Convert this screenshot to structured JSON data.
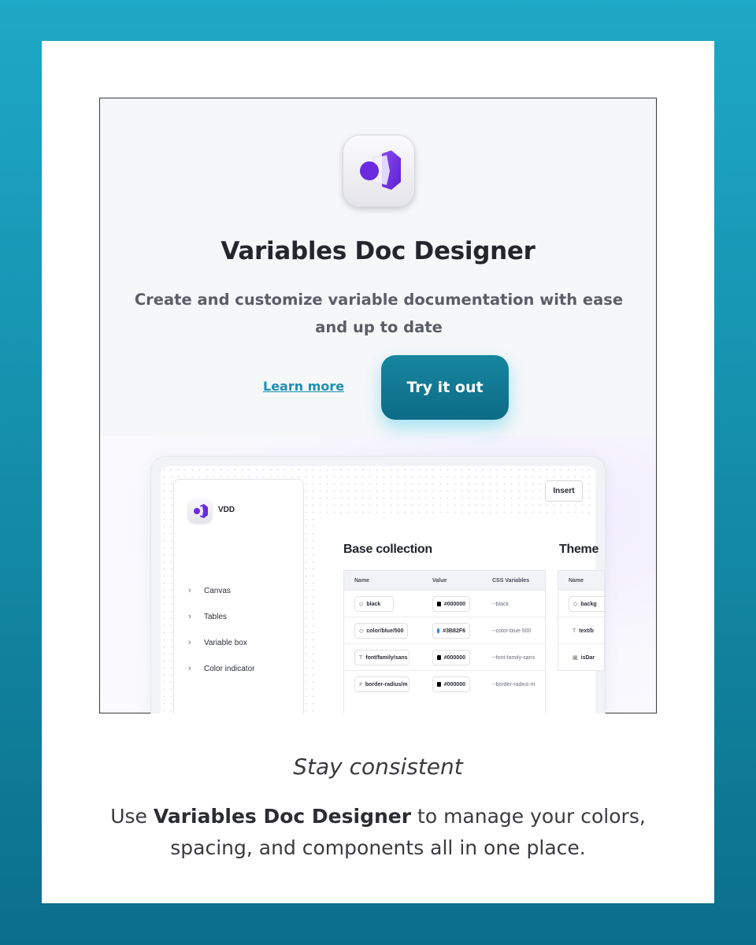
{
  "hero": {
    "title": "Variables Doc Designer",
    "subtitle": "Create and customize variable documentation with ease and up to date",
    "learn_more": "Learn more",
    "try_button": "Try it out",
    "accent_color": "#0d6b86",
    "icon": "variables-doc-designer-app-icon"
  },
  "preview": {
    "app_short_name": "VDD",
    "insert_button": "Insert",
    "nav": [
      "Canvas",
      "Tables",
      "Variable box",
      "Color indicator"
    ],
    "collection_title": "Base collection",
    "theme_title": "Theme",
    "columns": [
      "Name",
      "Value",
      "CSS Variables"
    ],
    "rows": [
      {
        "name": "black",
        "value": "#000000",
        "swatch": "#000000",
        "css": "--black"
      },
      {
        "name": "color/blue/500",
        "value": "#3B82F6",
        "swatch": "#3b82f6",
        "css": "--color-blue-500"
      },
      {
        "name": "font/family/sans",
        "value": "#000000",
        "swatch": "#000000",
        "css": "--font-family-sans"
      },
      {
        "name": "border-radius/m",
        "value": "#000000",
        "swatch": "#000000",
        "css": "--border-radius-m"
      }
    ],
    "theme_columns": [
      "Name"
    ],
    "theme_rows": [
      "backg",
      "text/b",
      "isDar"
    ]
  },
  "caption": {
    "heading": "Stay consistent",
    "body_prefix": "Use ",
    "body_bold": "Variables Doc Designer",
    "body_suffix": " to manage your colors, spacing, and components all in one place."
  }
}
